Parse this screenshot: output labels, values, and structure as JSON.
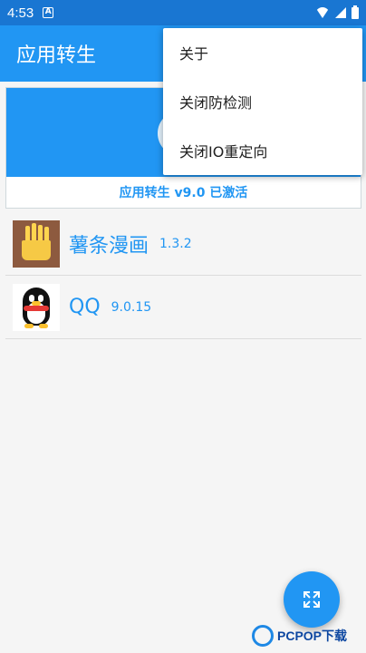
{
  "status_bar": {
    "time": "4:53",
    "notif_badge": "A"
  },
  "app_bar": {
    "title": "应用转生"
  },
  "card": {
    "status_text": "应用转生 v9.0 已激活"
  },
  "apps": [
    {
      "name": "薯条漫画",
      "version": "1.3.2",
      "icon": "shutiao-manhua-icon",
      "icon_text": "薯条漫画"
    },
    {
      "name": "QQ",
      "version": "9.0.15",
      "icon": "qq-penguin-icon"
    }
  ],
  "menu": {
    "items": [
      {
        "label": "关于"
      },
      {
        "label": "关闭防检测"
      },
      {
        "label": "关闭IO重定向"
      }
    ]
  },
  "fab": {
    "icon": "fullscreen-expand-icon"
  },
  "watermark": {
    "text": "PCPOP下载"
  },
  "colors": {
    "primary": "#2196f3",
    "primary_dark": "#1976d2",
    "accent_text": "#2196f3"
  }
}
